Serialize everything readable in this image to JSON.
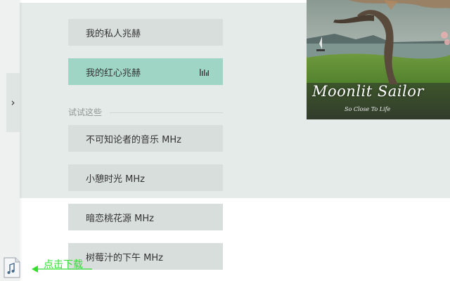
{
  "channels_primary": [
    {
      "label": "我的私人兆赫",
      "active": false
    },
    {
      "label": "我的红心兆赫",
      "active": true
    }
  ],
  "section": {
    "label": "试试这些"
  },
  "channels_suggested": [
    {
      "label": "不可知论者的音乐 MHz"
    },
    {
      "label": "小憩时光 MHz"
    },
    {
      "label": "暗恋桃花源 MHz"
    },
    {
      "label": "树莓汁的下午 MHz"
    }
  ],
  "sidebar": {
    "toggle_glyph": "›"
  },
  "album": {
    "title": "Moonlit Sailor",
    "subtitle": "So Close To Life"
  },
  "download": {
    "label": "点击下载",
    "icon": "music-file-icon"
  },
  "colors": {
    "active_channel": "#9fd5c4",
    "channel": "#d7dedb",
    "backdrop": "#e5ebe8",
    "download_accent": "#33dd33"
  }
}
